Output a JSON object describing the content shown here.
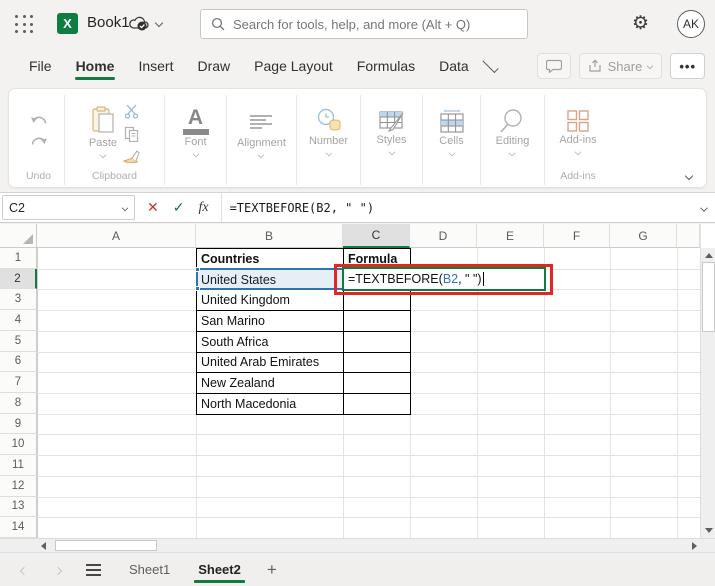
{
  "topbar": {
    "workbook_title": "Book1",
    "search_placeholder": "Search for tools, help, and more (Alt + Q)",
    "avatar_initials": "AK"
  },
  "menubar": {
    "items": [
      "File",
      "Home",
      "Insert",
      "Draw",
      "Page Layout",
      "Formulas",
      "Data"
    ],
    "active_item": "Home",
    "share_label": "Share",
    "more_label": "•••"
  },
  "ribbon": {
    "undo_group_label": "Undo",
    "paste_label": "Paste",
    "clipboard_group_label": "Clipboard",
    "addins_group_label": "Add-ins",
    "buttons": [
      "Font",
      "Alignment",
      "Number",
      "Styles",
      "Cells",
      "Editing",
      "Add-ins"
    ]
  },
  "formula_bar": {
    "name_box_value": "C2",
    "fx_label": "fx",
    "formula": "=TEXTBEFORE(B2, \" \")"
  },
  "grid": {
    "column_headers": [
      "A",
      "B",
      "C",
      "D",
      "E",
      "F",
      "G"
    ],
    "row_count": 14,
    "selected_column": "C",
    "selected_row": 2,
    "table": {
      "header_b": "Countries",
      "header_c": "Formula",
      "countries": [
        "United States",
        "United Kingdom",
        "San Marino",
        "South Africa",
        "United Arab Emirates",
        "New Zealand",
        "North Macedonia"
      ]
    },
    "edit_cell": {
      "cell": "C2",
      "prefix": "=TEXTBEFORE(",
      "ref": "B2",
      "suffix": ", \" \")"
    }
  },
  "sheetbar": {
    "sheets": [
      "Sheet1",
      "Sheet2"
    ],
    "active_sheet": "Sheet2"
  },
  "colors": {
    "excel_green": "#107c41",
    "selection_blue": "#2e75b6",
    "reference_blue": "#2e75b6",
    "annotation_red": "#e0281e"
  }
}
